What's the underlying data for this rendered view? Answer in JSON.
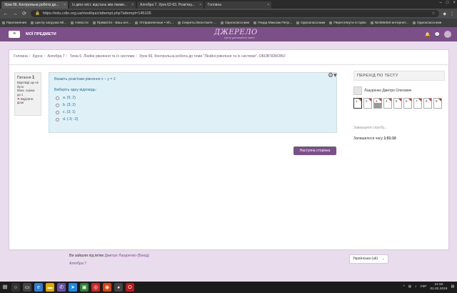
{
  "browser": {
    "tabs": [
      {
        "title": "Урок 66. Контрольна робота до...",
        "active": true
      },
      {
        "title": "Із двох міст, відстань між якими...",
        "active": false
      },
      {
        "title": "Алгебра 7. Урок 62-63. Розв'язу...",
        "active": false
      },
      {
        "title": "Головна",
        "active": false
      }
    ],
    "url": "https://edu.cdio.org.ua/mod/quiz/attempt.php?attempt=145105",
    "bookmarks": [
      "Приложения",
      "Центр загрузки Mi...",
      "Новости",
      "Приват24 - Ваш инт...",
      "Отправленные • Sh...",
      "Секреты Вконтакте ...",
      "Одноклассники",
      "Гнида Максим Петр...",
      "Одноклассники",
      "Переглянути історію",
      "NickMebel интернет...",
      "Одноклассники"
    ]
  },
  "site": {
    "menu_label": "МОЇ ПРЕДМЕТИ",
    "logo_text": "ДЖЕРЕЛО",
    "logo_sub": "Центр дистанційної освіти"
  },
  "breadcrumb": [
    "Головна",
    "Курси",
    "Алгебра 7",
    "Тема 6. Лінійні рівняння та їх системи",
    "Урок 66. Контрольна робота до теми \"Лінійні рівняння та їх системи\". ОБОВ'ЯЗКОВО"
  ],
  "question_info": {
    "label": "Питання",
    "number": "1",
    "status": "Відповіді ще не було",
    "marks": "Макс. оцінка до 1",
    "flag": "Виділити флаг"
  },
  "question": {
    "text": "Вкажіть розв'язки рівняння x – y = 2",
    "prompt": "Виберіть одну відповідь:",
    "options": [
      "a. (5; 2)",
      "b. (3; 2)",
      "c. (3; 1)",
      "d. (-3; -2)"
    ]
  },
  "next_button": "Наступна сторінка",
  "quiz_nav": {
    "title": "ПЕРЕХІД ПО ТЕСТУ",
    "user_name": "Лазуренко Дмитро Олегович",
    "cells": [
      {
        "label": "1",
        "state": "current"
      },
      {
        "label": "2",
        "state": "unanswered"
      },
      {
        "label": "3",
        "state": "answered"
      },
      {
        "label": "4",
        "state": "unanswered"
      },
      {
        "label": "5",
        "state": "unanswered"
      },
      {
        "label": "6",
        "state": "unanswered"
      },
      {
        "label": "7",
        "state": "unanswered"
      },
      {
        "label": "8",
        "state": "unanswered"
      },
      {
        "label": "9",
        "state": "unanswered"
      }
    ],
    "finish_label": "Завершити спробу...",
    "time_label": "Залишилося часу",
    "time_value": "1:01:10"
  },
  "footer": {
    "logged_in_prefix": "Ви зайшли під ім'ям",
    "user": "Дмитро Лазуренко",
    "logout": "(Вихід)",
    "course": "Алгебра 7",
    "language": "Українська (uk)"
  },
  "taskbar": {
    "lang": "УКР",
    "time": "21:50",
    "date": "01.02.2019"
  },
  "colors": {
    "brand": "#7b4f87",
    "question_bg": "#dff0f7",
    "flag": "#c0392b"
  }
}
